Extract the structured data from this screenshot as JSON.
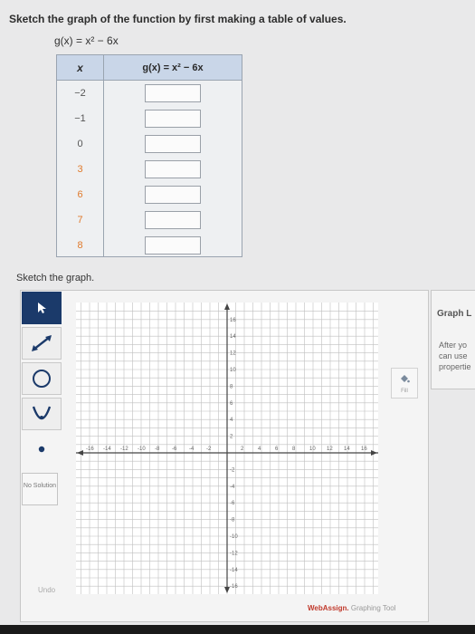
{
  "problem": {
    "instruction": "Sketch the graph of the function by first making a table of values.",
    "function_top": "g(x) = x² − 6x"
  },
  "table": {
    "header_x": "x",
    "header_g": "g(x) = x² − 6x",
    "x_values": [
      "−2",
      "−1",
      "0",
      "3",
      "6",
      "7",
      "8"
    ],
    "g_values": [
      "",
      "",
      "",
      "",
      "",
      "",
      ""
    ]
  },
  "sketch_label": "Sketch the graph.",
  "toolbar": {
    "no_solution_label": "No Solution",
    "undo_label": "Undo"
  },
  "graph": {
    "x_ticks": [
      "-16",
      "-14",
      "-12",
      "-10",
      "-8",
      "-6",
      "-4",
      "-2",
      "2",
      "4",
      "6",
      "8",
      "10",
      "12",
      "14",
      "16"
    ],
    "y_ticks": [
      "16",
      "14",
      "12",
      "10",
      "8",
      "6",
      "4",
      "2",
      "-2",
      "-4",
      "-6",
      "-8",
      "-10",
      "-12",
      "-14",
      "-16"
    ]
  },
  "fill_label": "Fill",
  "footer": {
    "brand": "WebAssign.",
    "tool": " Graphing Tool"
  },
  "side_panel": {
    "title": "Graph L",
    "line1": "After yo",
    "line2": "can use",
    "line3": "propertie"
  },
  "colors": {
    "tool_active": "#1b3a6a",
    "table_header": "#c9d6e8",
    "grid_line": "#bfbfbf",
    "axis": "#444444"
  }
}
